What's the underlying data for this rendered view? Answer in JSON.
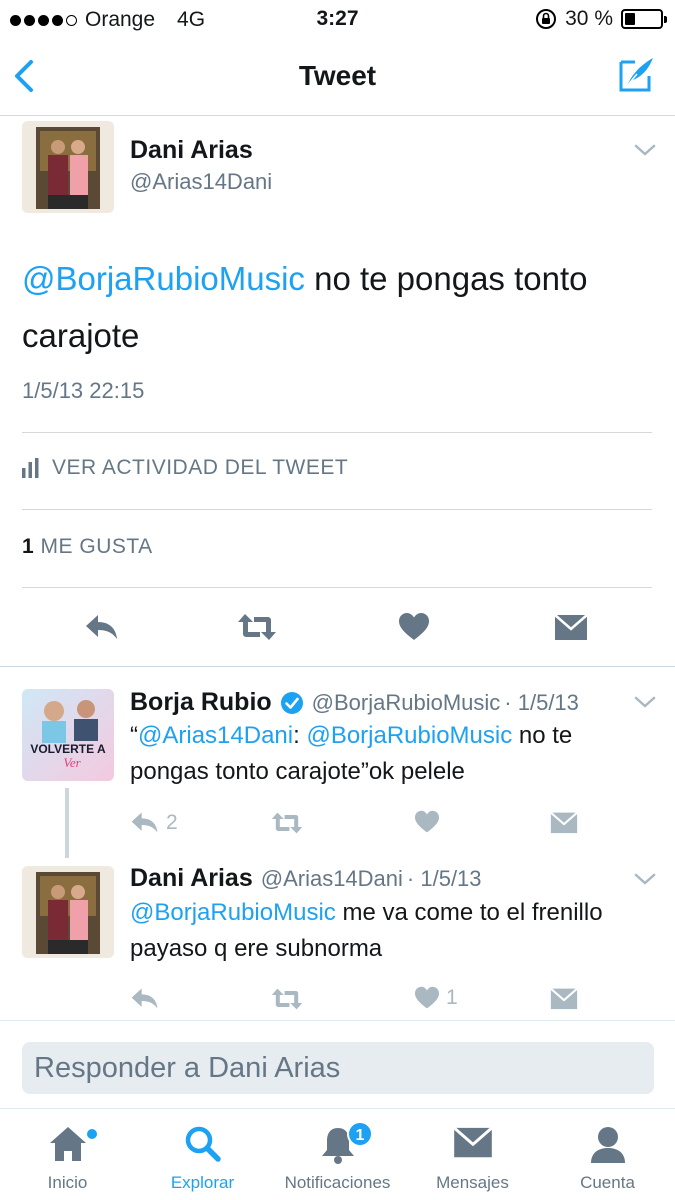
{
  "status": {
    "carrier": "Orange",
    "network": "4G",
    "time": "3:27",
    "battery_text": "30 %",
    "battery_level": 0.3
  },
  "nav": {
    "title": "Tweet"
  },
  "tweet": {
    "author_name": "Dani Arias",
    "author_handle": "@Arias14Dani",
    "mention": "@BorjaRubioMusic",
    "text": " no te pongas tonto carajote",
    "timestamp": "1/5/13 22:15",
    "activity_label": "VER ACTIVIDAD DEL TWEET",
    "likes_count": "1",
    "likes_label": "ME GUSTA"
  },
  "replies": [
    {
      "name": "Borja Rubio",
      "handle": "@BorjaRubioMusic",
      "date": "· 1/5/13",
      "quote_open": "“",
      "mention1": "@Arias14Dani",
      "colon": ": ",
      "mention2": "@BorjaRubioMusic",
      "text": " no te pongas tonto carajote”ok pelele",
      "reply_count": "2",
      "like_count": "",
      "avatar_text_1": "VOLVERTE A",
      "avatar_text_2": "Ver",
      "verified": true
    },
    {
      "name": "Dani Arias",
      "handle": "@Arias14Dani",
      "date": "· 1/5/13",
      "mention1": "@BorjaRubioMusic",
      "text": " me va come to el frenillo payaso q ere subnorma",
      "reply_count": "",
      "like_count": "1"
    }
  ],
  "reply_box": {
    "placeholder": "Responder a Dani Arias"
  },
  "tabs": [
    {
      "label": "Inicio",
      "icon": "home-icon"
    },
    {
      "label": "Explorar",
      "icon": "search-icon",
      "active": true
    },
    {
      "label": "Notificaciones",
      "icon": "bell-icon",
      "badge": "1"
    },
    {
      "label": "Mensajes",
      "icon": "envelope-icon"
    },
    {
      "label": "Cuenta",
      "icon": "person-icon"
    }
  ],
  "colors": {
    "accent": "#1da1f2",
    "muted": "#657786",
    "icon_gray": "#aab8c2"
  }
}
